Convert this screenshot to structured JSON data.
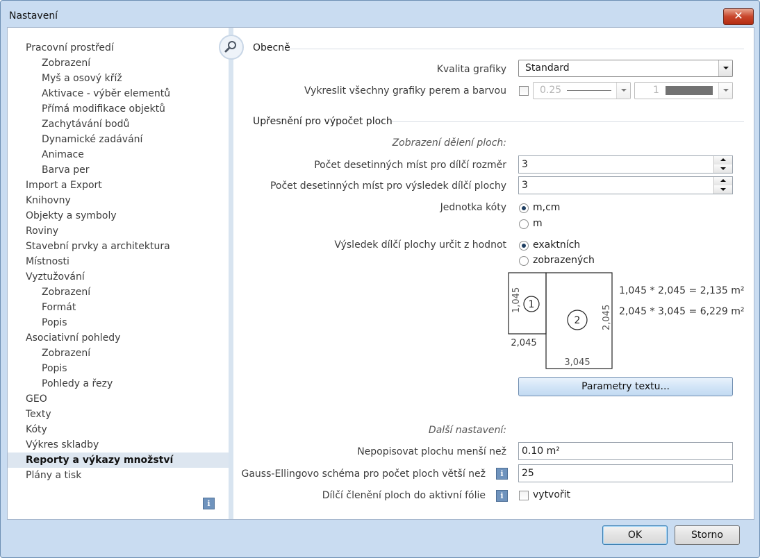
{
  "window": {
    "title": "Nastavení",
    "close_label": "✕"
  },
  "sidebar": {
    "items": [
      {
        "label": "Pracovní prostředí",
        "level": 0
      },
      {
        "label": "Zobrazení",
        "level": 1
      },
      {
        "label": "Myš a osový kříž",
        "level": 1
      },
      {
        "label": "Aktivace - výběr elementů",
        "level": 1
      },
      {
        "label": "Přímá modifikace objektů",
        "level": 1
      },
      {
        "label": "Zachytávání bodů",
        "level": 1
      },
      {
        "label": "Dynamické zadávání",
        "level": 1
      },
      {
        "label": "Animace",
        "level": 1
      },
      {
        "label": "Barva per",
        "level": 1
      },
      {
        "label": "Import a Export",
        "level": 0
      },
      {
        "label": "Knihovny",
        "level": 0
      },
      {
        "label": "Objekty a symboly",
        "level": 0
      },
      {
        "label": "Roviny",
        "level": 0
      },
      {
        "label": "Stavební prvky a architektura",
        "level": 0
      },
      {
        "label": "Místnosti",
        "level": 0
      },
      {
        "label": "Vyztužování",
        "level": 0
      },
      {
        "label": "Zobrazení",
        "level": 1
      },
      {
        "label": "Formát",
        "level": 1
      },
      {
        "label": "Popis",
        "level": 1
      },
      {
        "label": "Asociativní pohledy",
        "level": 0
      },
      {
        "label": "Zobrazení",
        "level": 1
      },
      {
        "label": "Popis",
        "level": 1
      },
      {
        "label": "Pohledy a řezy",
        "level": 1
      },
      {
        "label": "GEO",
        "level": 0
      },
      {
        "label": "Texty",
        "level": 0
      },
      {
        "label": "Kóty",
        "level": 0
      },
      {
        "label": "Výkres skladby",
        "level": 0
      },
      {
        "label": "Reporty a výkazy množství",
        "level": 0,
        "selected": true
      },
      {
        "label": "Plány a tisk",
        "level": 0
      }
    ],
    "info_glyph": "i"
  },
  "general": {
    "section_title": "Obecně",
    "graphics_quality_label": "Kvalita grafiky",
    "graphics_quality_value": "Standard",
    "draw_all_label": "Vykreslit všechny grafiky perem a barvou",
    "pen_value": "0.25",
    "color_value": "1"
  },
  "area_calc": {
    "section_title": "Upřesnění pro výpočet ploch",
    "subheading": "Zobrazení dělení ploch:",
    "decimals_partial_label": "Počet desetinných míst pro dílčí rozměr",
    "decimals_partial_value": "3",
    "decimals_result_label": "Počet desetinných míst pro výsledek dílčí plochy",
    "decimals_result_value": "3",
    "unit_label": "Jednotka kóty",
    "unit_options": [
      "m,cm",
      "m"
    ],
    "unit_selected": "m,cm",
    "result_label": "Výsledek dílčí plochy určit z hodnot",
    "result_options": [
      "exaktních",
      "zobrazených"
    ],
    "result_selected": "exaktních",
    "diagram": {
      "rect1_height": "1,045",
      "rect1_width": "2,045",
      "rect1_number": "1",
      "rect2_height": "2,045",
      "rect2_width": "3,045",
      "rect2_number": "2",
      "formula1": "1,045 * 2,045 = 2,135 m²",
      "formula2": "2,045 * 3,045 = 6,229 m²"
    },
    "text_params_button": "Parametry textu..."
  },
  "other": {
    "subheading": "Další nastavení:",
    "min_area_label": "Nepopisovat plochu menší než",
    "min_area_value": "0.10 m²",
    "gauss_label": "Gauss-Ellingovo schéma pro počet ploch větší než",
    "gauss_value": "25",
    "partial_label": "Dílčí členění ploch do aktivní fólie",
    "partial_option": "vytvořit"
  },
  "footer": {
    "ok_label": "OK",
    "cancel_label": "Storno"
  }
}
